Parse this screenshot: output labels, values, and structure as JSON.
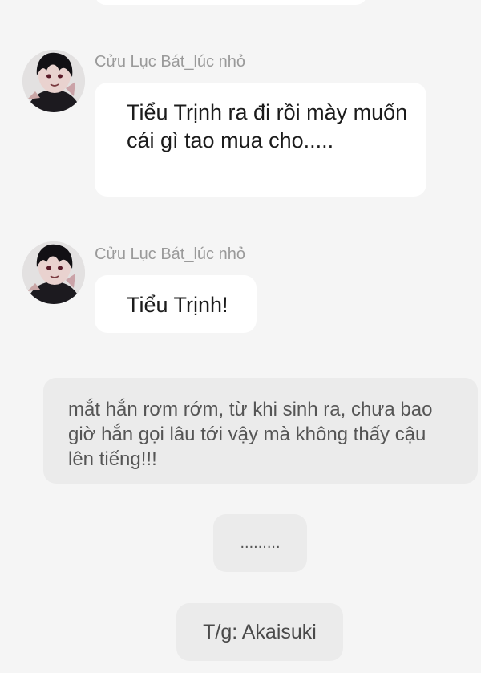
{
  "messages": [
    {
      "sender": "Cửu Lục Bát_lúc nhỏ",
      "text": "Tiểu Trịnh ra đi rồi mày muốn cái gì tao mua cho.....",
      "avatar_icon": "character-avatar-icon"
    },
    {
      "sender": "Cửu Lục Bát_lúc nhỏ",
      "text": "Tiểu Trịnh!",
      "avatar_icon": "character-avatar-icon"
    }
  ],
  "narration": "mắt hắn rơm rớm, từ khi sinh ra, chưa bao giờ hắn gọi lâu tới vậy mà không thấy cậu lên tiếng!!!",
  "ellipsis": ".........",
  "credit": "T/g: Akaisuki",
  "colors": {
    "background": "#f5f5f5",
    "bubble": "#ffffff",
    "system_bubble": "#ebebeb",
    "name": "#9a9a9a"
  }
}
